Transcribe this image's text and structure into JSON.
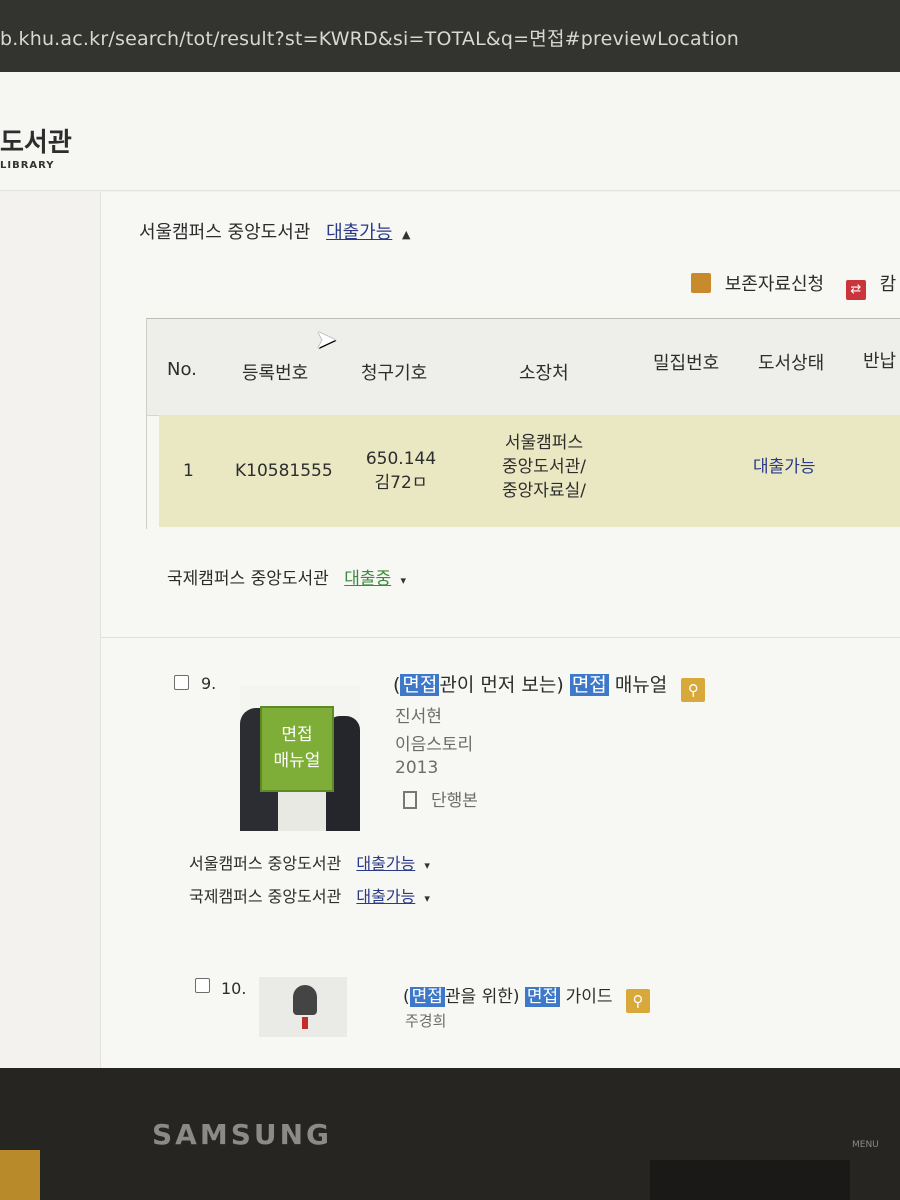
{
  "browser": {
    "url": "b.khu.ac.kr/search/tot/result?st=KWRD&si=TOTAL&q=면접#previewLocation"
  },
  "site": {
    "logo_text": "도서관",
    "logo_sub": "LIBRARY"
  },
  "holding_top": {
    "library": "서울캠퍼스 중앙도서관",
    "status": "대출가능",
    "actions": {
      "preserve_request": "보존자료신청",
      "cut_label": "캄"
    },
    "table": {
      "headers": [
        "No.",
        "등록번호",
        "청구기호",
        "소장처",
        "밀집번호",
        "도서상태",
        "반납"
      ],
      "row": {
        "no": "1",
        "reg_no": "K10581555",
        "call_no_1": "650.144",
        "call_no_2": "김72ㅁ",
        "location_1": "서울캠퍼스",
        "location_2": "중앙도서관/",
        "location_3": "중앙자료실/",
        "status": "대출가능"
      }
    },
    "global_library": "국제캠퍼스 중앙도서관",
    "global_status": "대출중"
  },
  "results": [
    {
      "number": "9.",
      "title_pre": "(",
      "title_hl1": "면접",
      "title_mid": "관이 먼저 보는) ",
      "title_hl2": "면접",
      "title_post": " 매뉴얼",
      "author": "진서현",
      "publisher": "이음스토리",
      "year": "2013",
      "type": "단행본",
      "cover_text_1": "면접",
      "cover_text_2": "매뉴얼",
      "holdings": [
        {
          "library": "서울캠퍼스 중앙도서관",
          "status": "대출가능"
        },
        {
          "library": "국제캠퍼스 중앙도서관",
          "status": "대출가능"
        }
      ]
    },
    {
      "number": "10.",
      "title_pre": "(",
      "title_hl1": "면접",
      "title_mid": "관을 위한) ",
      "title_hl2": "면접",
      "title_post": " 가이드",
      "author": "주경희"
    }
  ],
  "monitor": {
    "brand": "SAMSUNG",
    "menu": "MENU"
  }
}
